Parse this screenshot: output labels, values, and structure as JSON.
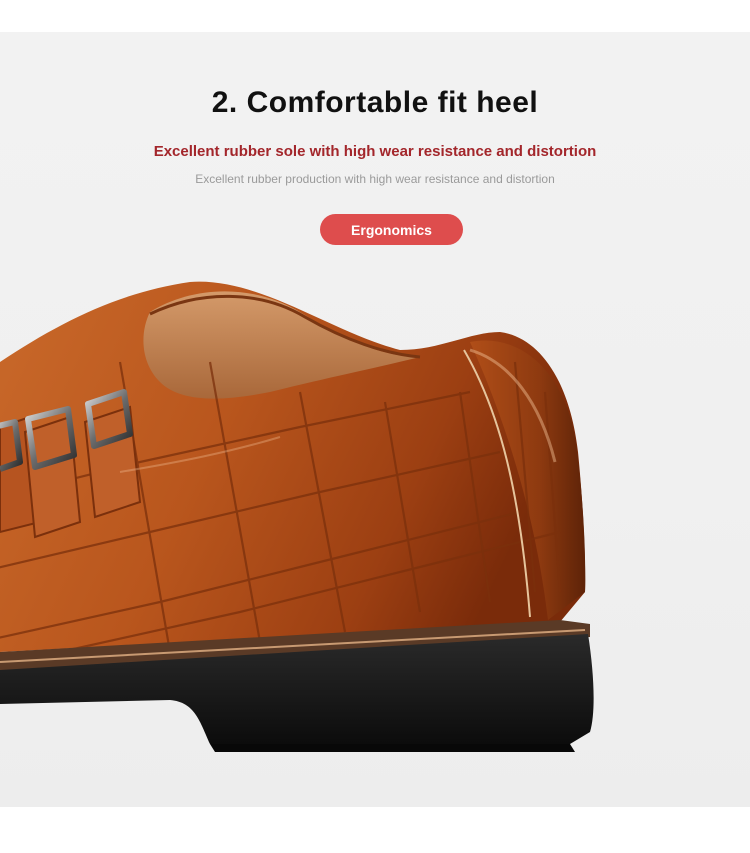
{
  "section": {
    "title": "2. Comfortable fit heel",
    "subtitle": "Excellent rubber sole with high wear resistance and distortion",
    "description": "Excellent rubber production with high wear resistance and distortion",
    "badge": "Ergonomics"
  },
  "colors": {
    "accent": "#a3262b",
    "badge": "#de4d4d",
    "leather": "#b8561e",
    "sole": "#161616"
  }
}
